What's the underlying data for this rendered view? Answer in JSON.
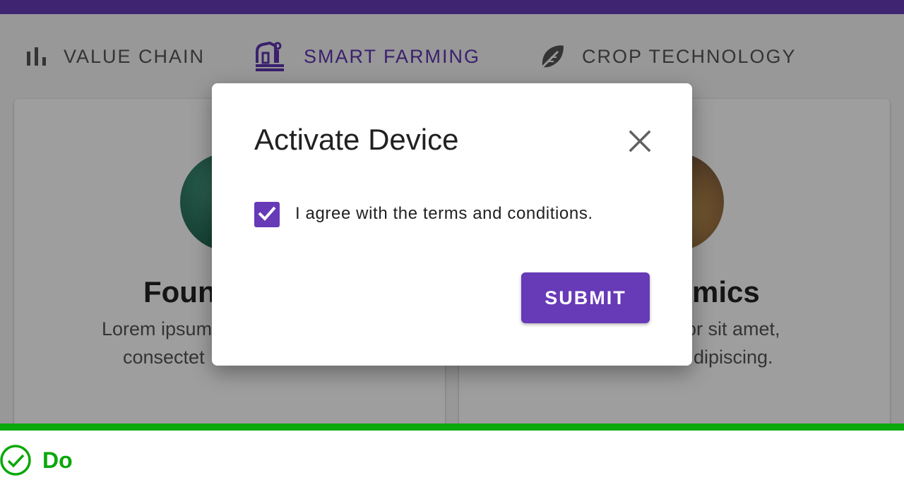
{
  "tabs": [
    {
      "label": "VALUE CHAIN",
      "icon": "bar-chart-icon",
      "active": false
    },
    {
      "label": "SMART FARMING",
      "icon": "barn-icon",
      "active": true
    },
    {
      "label": "CROP TECHNOLOGY",
      "icon": "leaf-icon",
      "active": false
    }
  ],
  "cards": [
    {
      "title": "Foun",
      "text_line1": "Lorem ipsum",
      "text_line2": "consectet"
    },
    {
      "title": "mics",
      "text_line1": "olor sit amet,",
      "text_line2": "dipiscing."
    }
  ],
  "dialog": {
    "title": "Activate Device",
    "close_icon": "close-icon",
    "checkbox_checked": true,
    "checkbox_label": "I agree with the terms and conditions.",
    "submit_label": "SUBMIT"
  },
  "footer": {
    "icon": "check-circle-icon",
    "label": "Do"
  },
  "colors": {
    "primary": "#673ab7",
    "active_tab": "#5e35b1",
    "success": "#0aa80a"
  }
}
